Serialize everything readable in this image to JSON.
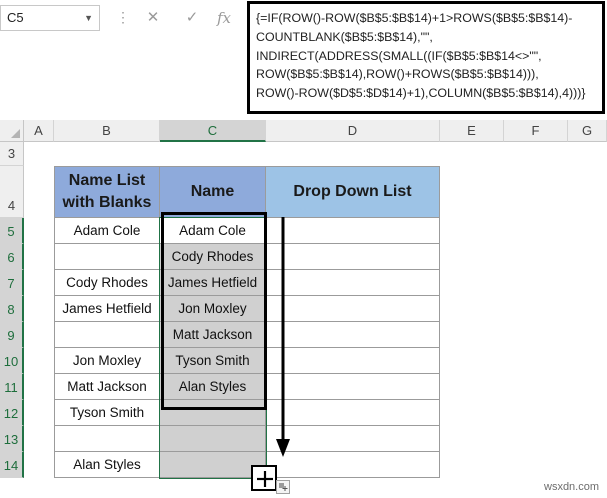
{
  "formula_bar": {
    "name_box": "C5",
    "cancel_symbol": "✕",
    "enter_symbol": "✓",
    "fx_label": "fx",
    "formula_lines": [
      "{=IF(ROW()-ROW($B$5:$B$14)+1>ROWS($B$5:$B$14)-",
      "COUNTBLANK($B$5:$B$14),\"\",",
      "INDIRECT(ADDRESS(SMALL((IF($B$5:$B$14<>\"\",",
      "ROW($B$5:$B$14),ROW()+ROWS($B$5:$B$14))),",
      "ROW()-ROW($D$5:$D$14)+1),COLUMN($B$5:$B$14),4)))}"
    ]
  },
  "columns": [
    "A",
    "B",
    "C",
    "D",
    "E",
    "F",
    "G"
  ],
  "rows": [
    "3",
    "4",
    "5",
    "6",
    "7",
    "8",
    "9",
    "10",
    "11",
    "12",
    "13",
    "14"
  ],
  "table": {
    "headers": [
      "Name List with Blanks",
      "Name",
      "Drop Down List"
    ],
    "col_b": [
      "Adam Cole",
      "",
      "Cody Rhodes",
      "James Hetfield",
      "",
      "Jon Moxley",
      "Matt Jackson",
      "Tyson Smith",
      "",
      "Alan Styles"
    ],
    "col_c": [
      "Adam Cole",
      "Cody Rhodes",
      "James Hetfield",
      "Jon Moxley",
      "Matt Jackson",
      "Tyson Smith",
      "Alan Styles",
      "",
      "",
      ""
    ]
  },
  "watermark": "wsxdn.com",
  "colors": {
    "header_fill": "#8eaadb",
    "drop_down_header_fill": "#9dc3e6",
    "selection_fill": "#d0d0d0",
    "selection_border": "#217346"
  }
}
